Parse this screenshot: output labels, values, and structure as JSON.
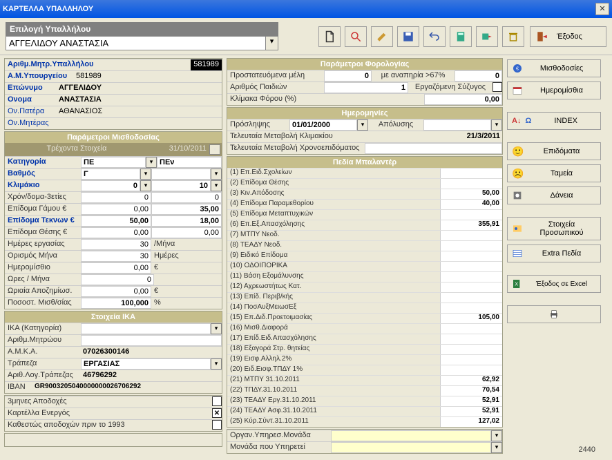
{
  "window": {
    "title": "ΚΑΡΤΕΛΛΑ ΥΠΑΛΛΗΛΟΥ"
  },
  "select": {
    "label": "Επιλογή Υπαλλήλου",
    "value": "ΑΓΓΕΛΙΔΟΥ ΑΝΑΣΤΑΣΙΑ"
  },
  "toolbar": {
    "exit": "Έξοδος"
  },
  "id": {
    "amyp_lbl": "Αριθμ.Μητρ.Υπαλλήλου",
    "amyp": "581989",
    "minyp_lbl": "Α.Μ.Υπουργείου",
    "minyp": "581989",
    "surname_lbl": "Επώνυμο",
    "surname": "ΑΓΓΕΛΙΔΟΥ",
    "name_lbl": "Ονομα",
    "name": "ΑΝΑΣΤΑΣΙΑ",
    "father_lbl": "Ον.Πατέρα",
    "father": "ΑΘΑΝΑΣΙΟΣ",
    "mother_lbl": "Ον.Μητέρας",
    "mother": ""
  },
  "payroll": {
    "hdr": "Παράμετροι Μισθοδοσίας",
    "subhdr_left": "Τρέχοντα Στοιχεία",
    "subhdr_right": "31/10/2011",
    "cat_lbl": "Κατηγορία",
    "cat": "ΠΕ",
    "cat2": "ΠΕν",
    "grade_lbl": "Βαθμός",
    "grade": "Γ",
    "step_lbl": "Κλιμάκιο",
    "step1": "0",
    "step2": "10",
    "years_lbl": "Χρόν/δομα-3ετίες",
    "years1": "0",
    "years2": "0",
    "marriage_lbl": "Επίδομα Γάμου  €",
    "marriage1": "0,00",
    "marriage2": "35,00",
    "children_lbl": "Επίδομα Τεκνων €",
    "children1": "50,00",
    "children2": "18,00",
    "position_lbl": "Επίδομα Θέσης  €",
    "position1": "0,00",
    "position2": "0,00",
    "workdays_lbl": "Ημέρες εργασίας",
    "workdays": "30",
    "workdays_unit": "/Μήνα",
    "monthdef_lbl": "Ορισμός Μήνα",
    "monthdef": "30",
    "monthdef_unit": "Ημέρες",
    "daily_lbl": "Ημερομίσθιο",
    "daily": "0,00",
    "daily_unit": "€",
    "hours_lbl": "Ωρες / Μήνα",
    "hours": "0",
    "hourly_lbl": "Ωριαία Αποζημίωσ.",
    "hourly": "0,00",
    "hourly_unit": "€",
    "pct_lbl": "Ποσοστ. Μισθ/σίας",
    "pct": "100,000",
    "pct_unit": "%"
  },
  "ika": {
    "hdr": "Στοιχεία IKA",
    "cat_lbl": "ΙΚΑ (Κατηγορία)",
    "cat": "",
    "reg_lbl": "Αριθμ.Μητρώου",
    "reg": "",
    "amka_lbl": "Α.Μ.Κ.Α.",
    "amka": "07026300146",
    "bank_lbl": "Τράπεζα",
    "bank": "ΕΡΓΑΣΙΑΣ",
    "acct_lbl": "Αριθ.Λογ.Τράπεζας",
    "acct": "46796292",
    "iban_lbl": "IBAN",
    "iban": "GR9003205040000000026706292",
    "tri_lbl": "3μηνες Αποδοχές",
    "active_lbl": "Καρτέλλα Ενεργός",
    "pre93_lbl": "Καθεστώς αποδοχών πριν το 1993"
  },
  "tax": {
    "hdr": "Παράμετροι Φορολογίας",
    "prot_lbl": "Προστατευόμενα μέλη",
    "prot": "0",
    "disab_lbl": "με αναπηρία >67%",
    "disab": "0",
    "kids_lbl": "Αριθμός  Παιδιών",
    "kids": "1",
    "spouse_lbl": "Εργαζόμενη  Σύζυγος",
    "scale_lbl": "Κλίμακα Φόρου (%)",
    "scale": "0,00"
  },
  "dates": {
    "hdr": "Ημερομηνίες",
    "hire_lbl": "Πρόσληψης",
    "hire": "01/01/2000",
    "fire_lbl": "Απόλυσης",
    "fire": "",
    "lastk_lbl": "Τελευταία Μεταβολή Κλιμακίου",
    "lastk": "21/3/2011",
    "lastx_lbl": "Τελευταία Μεταβολή Χρονοεπιδόματος",
    "lastx": ""
  },
  "balander": {
    "hdr": "Πεδία Μπαλαντέρ",
    "rows": [
      {
        "l": "(1) Επ.Ειδ.Σχολείων",
        "v": ""
      },
      {
        "l": "(2) Επίδομα Θέσης",
        "v": ""
      },
      {
        "l": "(3) Κιν.Απόδοσης",
        "v": "50,00"
      },
      {
        "l": "(4) Επίδομα Παραμεθορίου",
        "v": "40,00"
      },
      {
        "l": "(5) Επίδομα Μεταπτυχικών",
        "v": ""
      },
      {
        "l": "(6) Επ.Εξ.Απασχόλησης",
        "v": "355,91"
      },
      {
        "l": "(7) ΜΤΠΥ Νεοδ.",
        "v": ""
      },
      {
        "l": "(8) ΤΕΑΔΥ Νεοδ.",
        "v": ""
      },
      {
        "l": "(9) Ειδικό Επίδομα",
        "v": ""
      },
      {
        "l": "(10) ΟΔΟΙΠΟΡΙΚΑ",
        "v": ""
      },
      {
        "l": "(11) Βάση Εξομάλυνσης",
        "v": ""
      },
      {
        "l": "(12) Αχρεωστήτως Κατ.",
        "v": ""
      },
      {
        "l": "(13) Επίδ. Περιβ/κής",
        "v": ""
      },
      {
        "l": "(14) ΠοσΑυξΜειωσΕξ",
        "v": ""
      },
      {
        "l": "(15) Επ.Διδ.Προετοιμασίας",
        "v": "105,00"
      },
      {
        "l": "(16) Μισθ.Διαφορά",
        "v": ""
      },
      {
        "l": "(17) Επίδ.Ειδ.Απασχόλησης",
        "v": ""
      },
      {
        "l": "(18) Εξαγορά Στρ. θητείας",
        "v": ""
      },
      {
        "l": "(19) Εισφ.Αλληλ.2%",
        "v": ""
      },
      {
        "l": "(20) Ειδ.Εισφ.ΤΠΔΥ 1%",
        "v": ""
      },
      {
        "l": "(21) ΜΤΠΥ 31.10.2011",
        "v": "62,92"
      },
      {
        "l": "(22) ΤΠΔΥ.31.10.2011",
        "v": "70,54"
      },
      {
        "l": "(23) ΤΕΑΔΥ Εργ.31.10.2011",
        "v": "52,91"
      },
      {
        "l": "(24) ΤΕΑΔΥ Ασφ.31.10.2011",
        "v": "52,91"
      },
      {
        "l": "(25) Κύρ.Σύντ.31.10.2011",
        "v": "127,02"
      }
    ],
    "org_lbl": "Οργαν.Υπηρεσ.Μονάδα",
    "unit_lbl": "Μονάδα που Υπηρετεί"
  },
  "side": {
    "payrolls": "Μισθοδοσίες",
    "daily": "Ημερομίσθια",
    "index": "INDEX",
    "allow": "Επιδόματα",
    "funds": "Ταμεία",
    "loans": "Δάνεια",
    "staff1": "Στοιχεία",
    "staff2": "Προσωπικού",
    "extra": "Extra Πεδία",
    "excel": "Έξοδος σε Excel"
  },
  "footer": "2440"
}
